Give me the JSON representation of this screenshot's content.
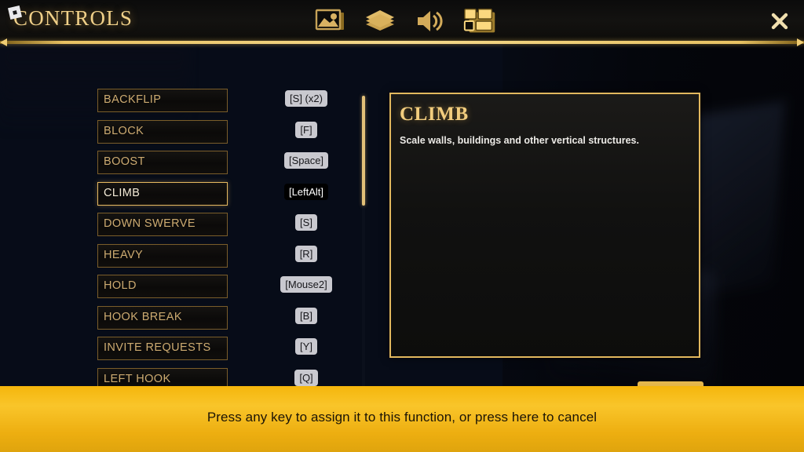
{
  "header": {
    "title": "CONTROLS",
    "logo_icon": "roblox-logo-icon",
    "close_icon": "close-icon",
    "tabs": [
      {
        "id": "graphics",
        "icon": "graphics-picture-icon",
        "label": "Graphics",
        "selected": false
      },
      {
        "id": "layers",
        "icon": "layers-icon",
        "label": "Layers",
        "selected": false
      },
      {
        "id": "audio",
        "icon": "speaker-volume-icon",
        "label": "Audio",
        "selected": false
      },
      {
        "id": "controls",
        "icon": "layout-blocks-icon",
        "label": "Controls",
        "selected": true
      }
    ]
  },
  "bindings": [
    {
      "name": "BACKFLIP",
      "key": "[S] (x2)",
      "selected": false
    },
    {
      "name": "BLOCK",
      "key": "[F]",
      "selected": false
    },
    {
      "name": "BOOST",
      "key": "[Space]",
      "selected": false
    },
    {
      "name": "CLIMB",
      "key": "[LeftAlt]",
      "selected": true
    },
    {
      "name": "DOWN SWERVE",
      "key": "[S]",
      "selected": false
    },
    {
      "name": "HEAVY",
      "key": "[R]",
      "selected": false
    },
    {
      "name": "HOLD",
      "key": "[Mouse2]",
      "selected": false
    },
    {
      "name": "HOOK BREAK",
      "key": "[B]",
      "selected": false
    },
    {
      "name": "INVITE REQUESTS",
      "key": "[Y]",
      "selected": false
    },
    {
      "name": "LEFT HOOK",
      "key": "[Q]",
      "selected": false
    }
  ],
  "detail": {
    "title": "CLIMB",
    "description": "Scale walls, buildings and other vertical structures."
  },
  "banner": {
    "text": "Press any key to assign it to this function, or press here to cancel"
  },
  "colors": {
    "gold": "#e2b85e",
    "gold_bright": "#f2cd7e",
    "gold_dim": "#7a5d2a",
    "banner_yellow": "#f5b60c",
    "key_chip_bg": "#c9c9cf",
    "panel_bg": "#111110",
    "background_blue": "#16294c"
  }
}
